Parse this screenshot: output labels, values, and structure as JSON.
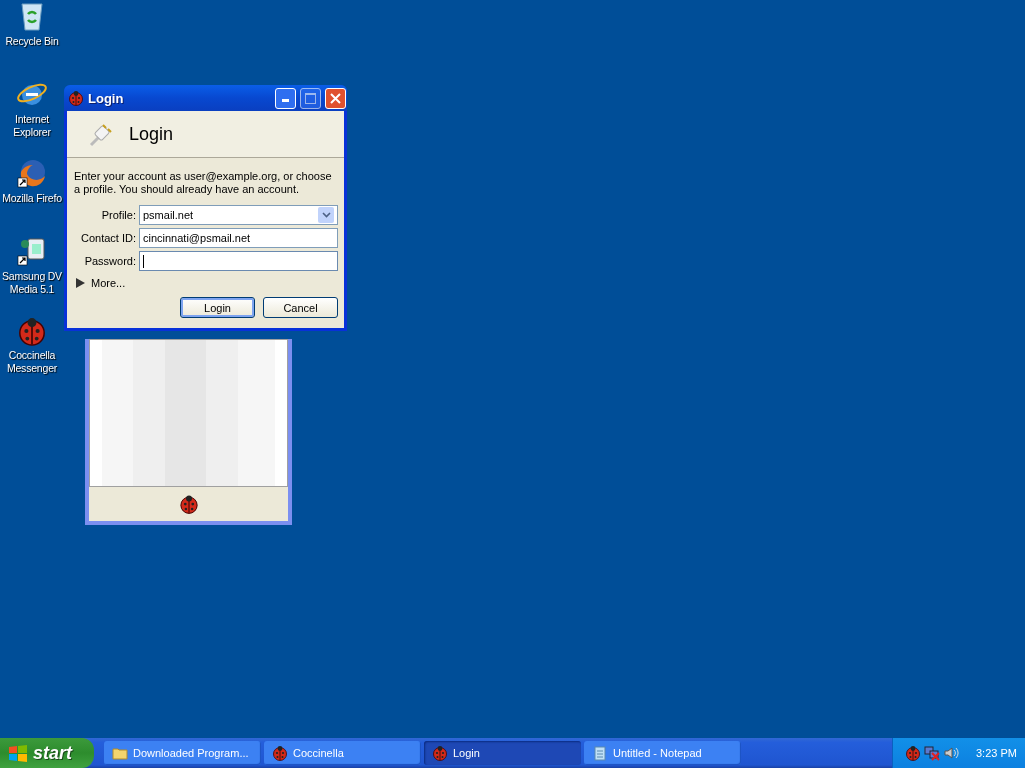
{
  "desktop_icons": [
    {
      "kind": "recycle",
      "label": "Recycle Bin"
    },
    {
      "kind": "browser",
      "label": "Internet Explorer"
    },
    {
      "kind": "firefox",
      "label": "Mozilla Firefo"
    },
    {
      "kind": "camera",
      "label": "Samsung DV Media 5.1"
    },
    {
      "kind": "ladybug",
      "label": "Coccinella Messenger"
    }
  ],
  "login_dialog": {
    "title": "Login",
    "heading": "Login",
    "description": "Enter your account as user@example.org, or choose a profile. You should already have an account.",
    "fields": [
      {
        "kind": "dropdown",
        "label": "Profile:",
        "value": "psmail.net"
      },
      {
        "kind": "text",
        "label": "Contact ID:",
        "value": "cincinnati@psmail.net",
        "focused": false
      },
      {
        "kind": "password",
        "label": "Password:",
        "focused": true
      }
    ],
    "more": {
      "label": "More...",
      "expanded": false
    },
    "buttons": [
      {
        "label": "Login",
        "default": true
      },
      {
        "label": "Cancel",
        "default": false
      }
    ]
  },
  "taskbar": {
    "start": "start",
    "items": [
      {
        "kind": "folder",
        "label": "Downloaded Program...",
        "selected": false
      },
      {
        "kind": "ladybug",
        "label": "Coccinella",
        "selected": false
      },
      {
        "kind": "ladybug",
        "label": "Login",
        "selected": true
      },
      {
        "kind": "notepad",
        "label": "Untitled - Notepad",
        "selected": false
      }
    ],
    "clock": "3:23 PM"
  }
}
